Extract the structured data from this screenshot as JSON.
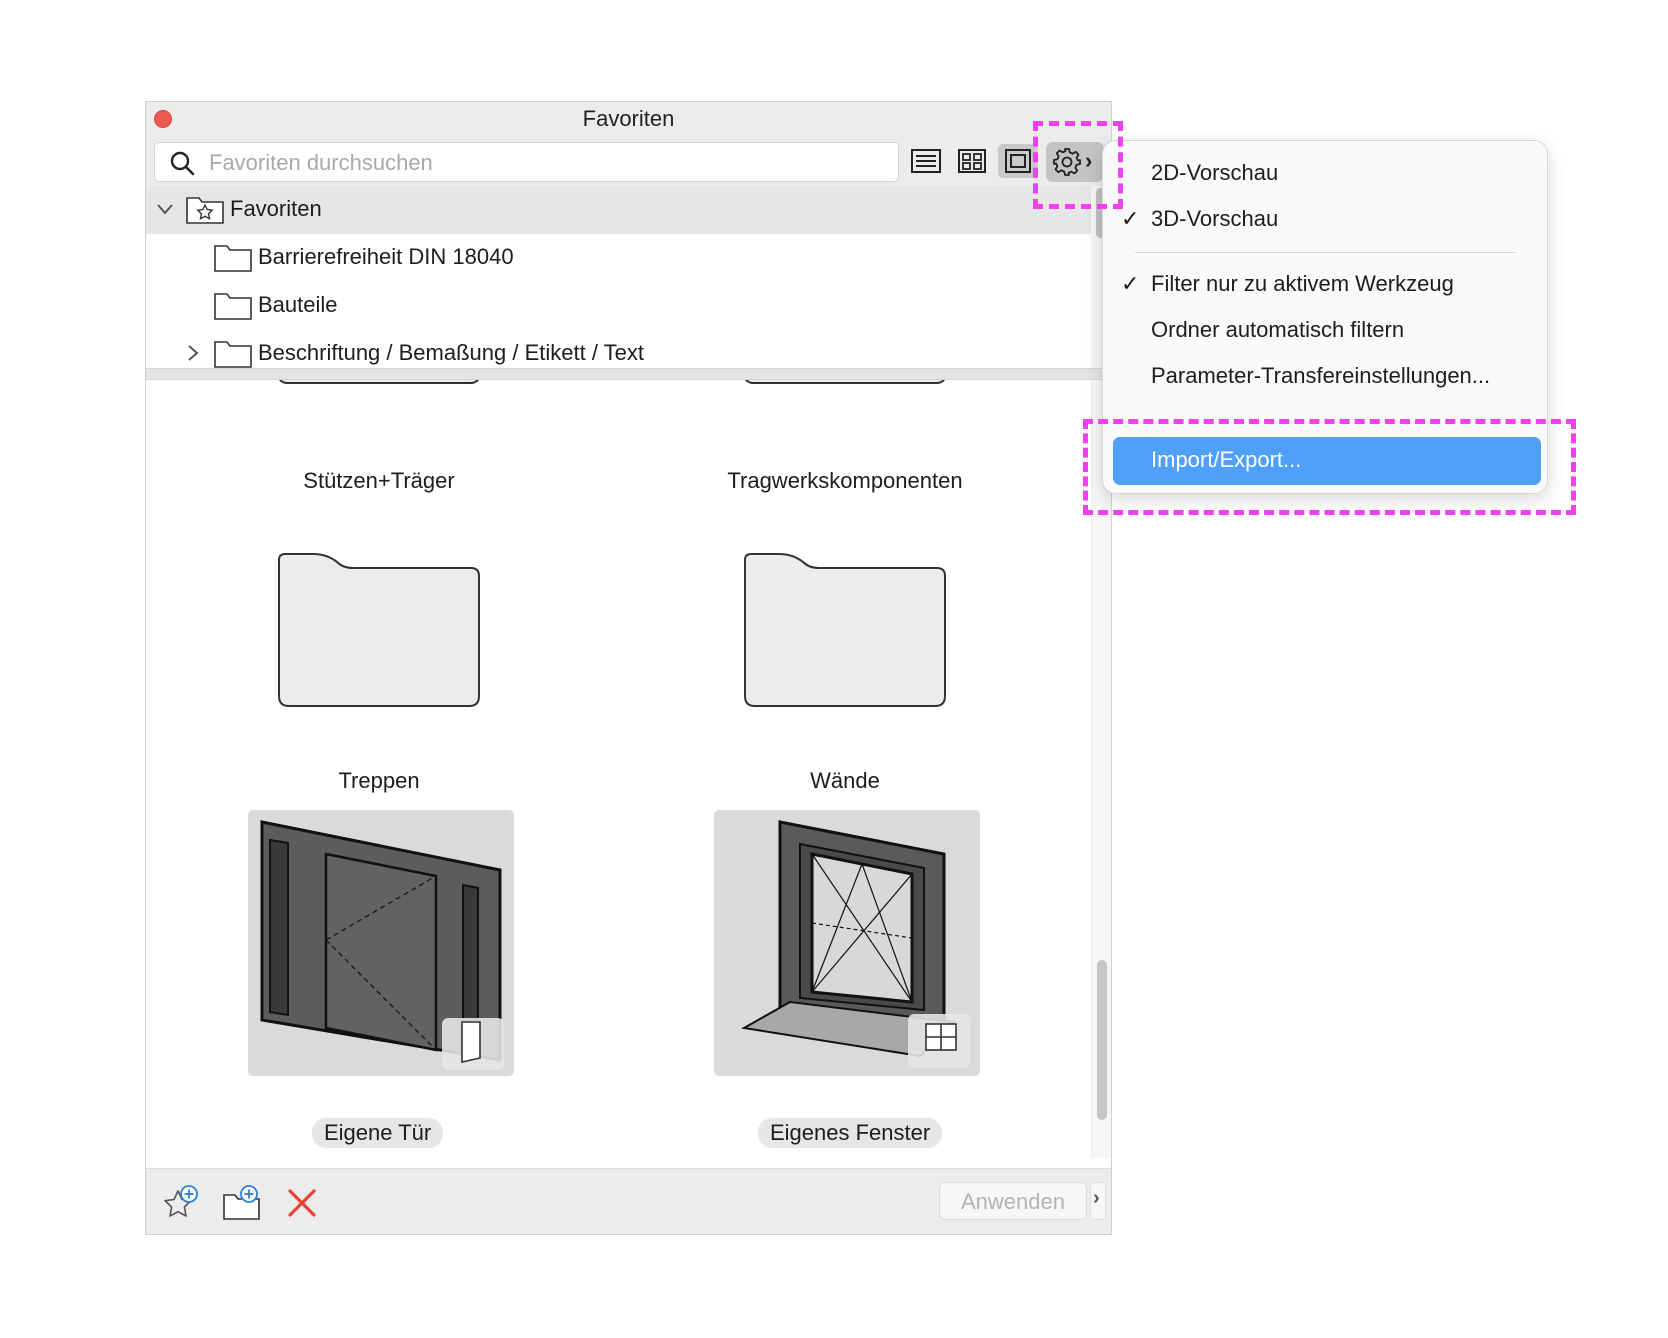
{
  "window": {
    "title": "Favoriten"
  },
  "search": {
    "placeholder": "Favoriten durchsuchen"
  },
  "toolbar": {
    "view_list_icon": "list-view-icon",
    "view_grid_icon": "grid-view-icon",
    "view_preview_icon": "preview-view-icon",
    "settings_icon": "gear-icon",
    "settings_chevron": "›"
  },
  "tree": {
    "root": {
      "label": "Favoriten",
      "expanded": true
    },
    "items": [
      {
        "label": "Barrierefreiheit DIN 18040",
        "expandable": false
      },
      {
        "label": "Bauteile",
        "expandable": false
      },
      {
        "label": "Beschriftung / Bemaßung / Etikett / Text",
        "expandable": true
      }
    ]
  },
  "grid": {
    "folders": [
      {
        "label": "Stützen+Träger"
      },
      {
        "label": "Tragwerkskomponenten"
      },
      {
        "label": "Treppen"
      },
      {
        "label": "Wände"
      }
    ],
    "objects": [
      {
        "label": "Eigene Tür",
        "badge_icon": "door-icon"
      },
      {
        "label": "Eigenes Fenster",
        "badge_icon": "window-icon"
      }
    ]
  },
  "bottom": {
    "add_favorite_icon": "add-favorite-icon",
    "add_folder_icon": "add-folder-icon",
    "delete_icon": "delete-icon",
    "apply_label": "Anwenden",
    "apply_more": "›"
  },
  "menu": {
    "items": [
      {
        "label": "2D-Vorschau",
        "checked": false
      },
      {
        "label": "3D-Vorschau",
        "checked": true
      },
      {
        "label": "Filter nur zu aktivem Werkzeug",
        "checked": true
      },
      {
        "label": "Ordner automatisch filtern",
        "checked": false
      },
      {
        "label": "Parameter-Transfereinstellungen...",
        "checked": false
      },
      {
        "label": "Import/Export...",
        "checked": false,
        "highlighted": true
      }
    ],
    "check_glyph": "✓"
  },
  "colors": {
    "highlight": "#4fa0f8",
    "annotation": "#f23ff0",
    "close": "#ee5a52",
    "delete": "#e8432f"
  }
}
